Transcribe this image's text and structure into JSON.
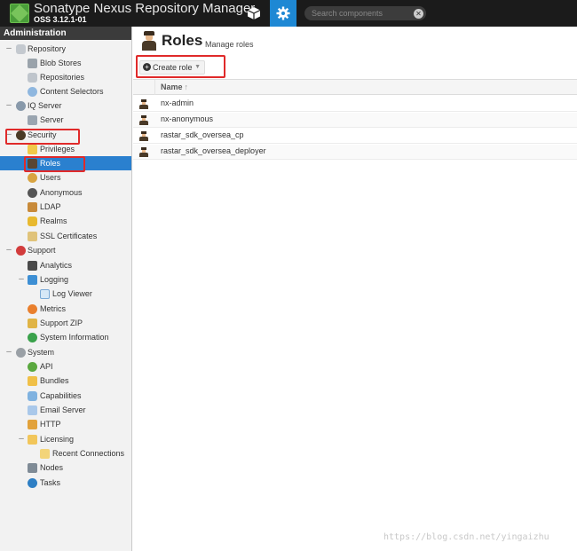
{
  "header": {
    "app_title": "Sonatype Nexus Repository Manager",
    "version": "OSS 3.12.1-01",
    "browse_icon": "cube-icon",
    "admin_icon": "gear-icon",
    "search_placeholder": "Search components",
    "search_clear_glyph": "✕"
  },
  "sidebar": {
    "title": "Administration",
    "items": {
      "repository": "Repository",
      "blob_stores": "Blob Stores",
      "repositories": "Repositories",
      "content_selectors": "Content Selectors",
      "iq_server": "IQ Server",
      "server": "Server",
      "security": "Security",
      "privileges": "Privileges",
      "roles": "Roles",
      "users": "Users",
      "anonymous": "Anonymous",
      "ldap": "LDAP",
      "realms": "Realms",
      "ssl_certificates": "SSL Certificates",
      "support": "Support",
      "analytics": "Analytics",
      "logging": "Logging",
      "log_viewer": "Log Viewer",
      "metrics": "Metrics",
      "support_zip": "Support ZIP",
      "system_information": "System Information",
      "system": "System",
      "api": "API",
      "bundles": "Bundles",
      "capabilities": "Capabilities",
      "email_server": "Email Server",
      "http": "HTTP",
      "licensing": "Licensing",
      "recent_connections": "Recent Connections",
      "nodes": "Nodes",
      "tasks": "Tasks"
    },
    "selected": "Roles",
    "toggle_glyph": "–"
  },
  "main": {
    "title": "Roles",
    "subtitle": "Manage roles",
    "create_button": "Create role",
    "create_plus": "+",
    "create_caret": "▼",
    "column_name": "Name",
    "sort_glyph": "↑",
    "rows": [
      "nx-admin",
      "nx-anonymous",
      "rastar_sdk_oversea_cp",
      "rastar_sdk_oversea_deployer"
    ]
  },
  "colors": {
    "header_bg": "#1b1b1b",
    "accent": "#1e88d4",
    "selected_bg": "#2a80cf",
    "highlight_red": "#e02a2a"
  },
  "watermark": "https://blog.csdn.net/yingaizhu"
}
